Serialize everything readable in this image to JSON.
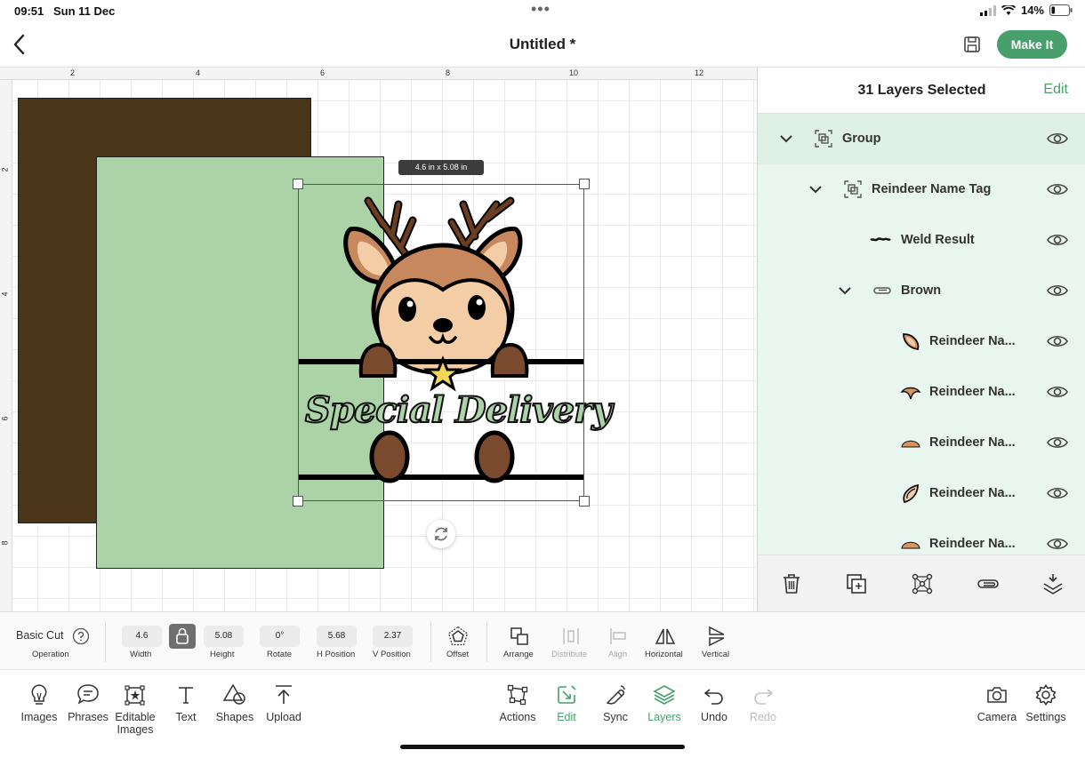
{
  "status_bar": {
    "time": "09:51",
    "date": "Sun 11 Dec",
    "battery": "14%"
  },
  "header": {
    "title": "Untitled *",
    "make_it_label": "Make It"
  },
  "canvas": {
    "ruler_top": [
      "2",
      "4",
      "6",
      "8",
      "10",
      "12"
    ],
    "ruler_left": [
      "2",
      "4",
      "6",
      "8"
    ],
    "dimension_label": "4.6 in x 5.08 in",
    "artwork_text": "Special Delivery",
    "colors": {
      "brown_mat": "#4a3519",
      "green_mat": "#acd3a8"
    }
  },
  "layers_panel": {
    "title": "31 Layers Selected",
    "edit_label": "Edit",
    "items": [
      {
        "label": "Group",
        "icon": "group-icon",
        "expanded": true
      },
      {
        "label": "Reindeer Name Tag",
        "icon": "group-icon",
        "expanded": true
      },
      {
        "label": "Weld Result",
        "icon": "weld-icon"
      },
      {
        "label": "Brown",
        "icon": "attach-icon",
        "expanded": true
      },
      {
        "label": "Reindeer Na...",
        "icon": "ear-shape-icon"
      },
      {
        "label": "Reindeer Na...",
        "icon": "nose-shape-icon"
      },
      {
        "label": "Reindeer Na...",
        "icon": "semicircle-shape-icon"
      },
      {
        "label": "Reindeer Na...",
        "icon": "ear-shape-icon"
      },
      {
        "label": "Reindeer Na...",
        "icon": "semicircle-shape-icon"
      }
    ],
    "footer_icons": [
      "trash-icon",
      "duplicate-icon",
      "ungroup-icon",
      "attach-icon",
      "flatten-icon"
    ]
  },
  "edit_toolbar": {
    "operation_value": "Basic Cut",
    "operation_label": "Operation",
    "width_value": "4.6",
    "width_label": "Width",
    "height_value": "5.08",
    "height_label": "Height",
    "rotate_value": "0°",
    "rotate_label": "Rotate",
    "hpos_value": "5.68",
    "hpos_label": "H Position",
    "vpos_value": "2.37",
    "vpos_label": "V Position",
    "offset_label": "Offset",
    "arrange_label": "Arrange",
    "distribute_label": "Distribute",
    "align_label": "Align",
    "horizontal_label": "Horizontal",
    "vertical_label": "Vertical"
  },
  "bottom_bar": {
    "images": "Images",
    "phrases": "Phrases",
    "editable_images": "Editable Images",
    "text": "Text",
    "shapes": "Shapes",
    "upload": "Upload",
    "actions": "Actions",
    "edit": "Edit",
    "sync": "Sync",
    "layers": "Layers",
    "undo": "Undo",
    "redo": "Redo",
    "camera": "Camera",
    "settings": "Settings"
  },
  "accent_color": "#47a06c"
}
